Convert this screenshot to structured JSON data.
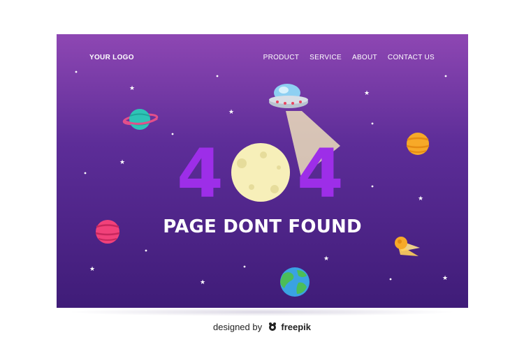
{
  "header": {
    "logo": "YOUR LOGO",
    "nav": [
      "PRODUCT",
      "SERVICE",
      "ABOUT",
      "CONTACT US"
    ]
  },
  "hero": {
    "code_left": "4",
    "code_right": "4",
    "message": "PAGE DONT FOUND"
  },
  "credit": {
    "prefix": "designed by",
    "brand": "freepik"
  },
  "colors": {
    "gradient_top": "#8e47b3",
    "gradient_bottom": "#3f1c78",
    "digits": "#9d2ee8",
    "moon": "#f7efb9"
  },
  "icons": [
    "ufo-icon",
    "moon-icon",
    "planet-teal-ringed-icon",
    "planet-orange-icon",
    "planet-pink-icon",
    "earth-icon",
    "comet-icon",
    "freepik-logo-icon"
  ]
}
